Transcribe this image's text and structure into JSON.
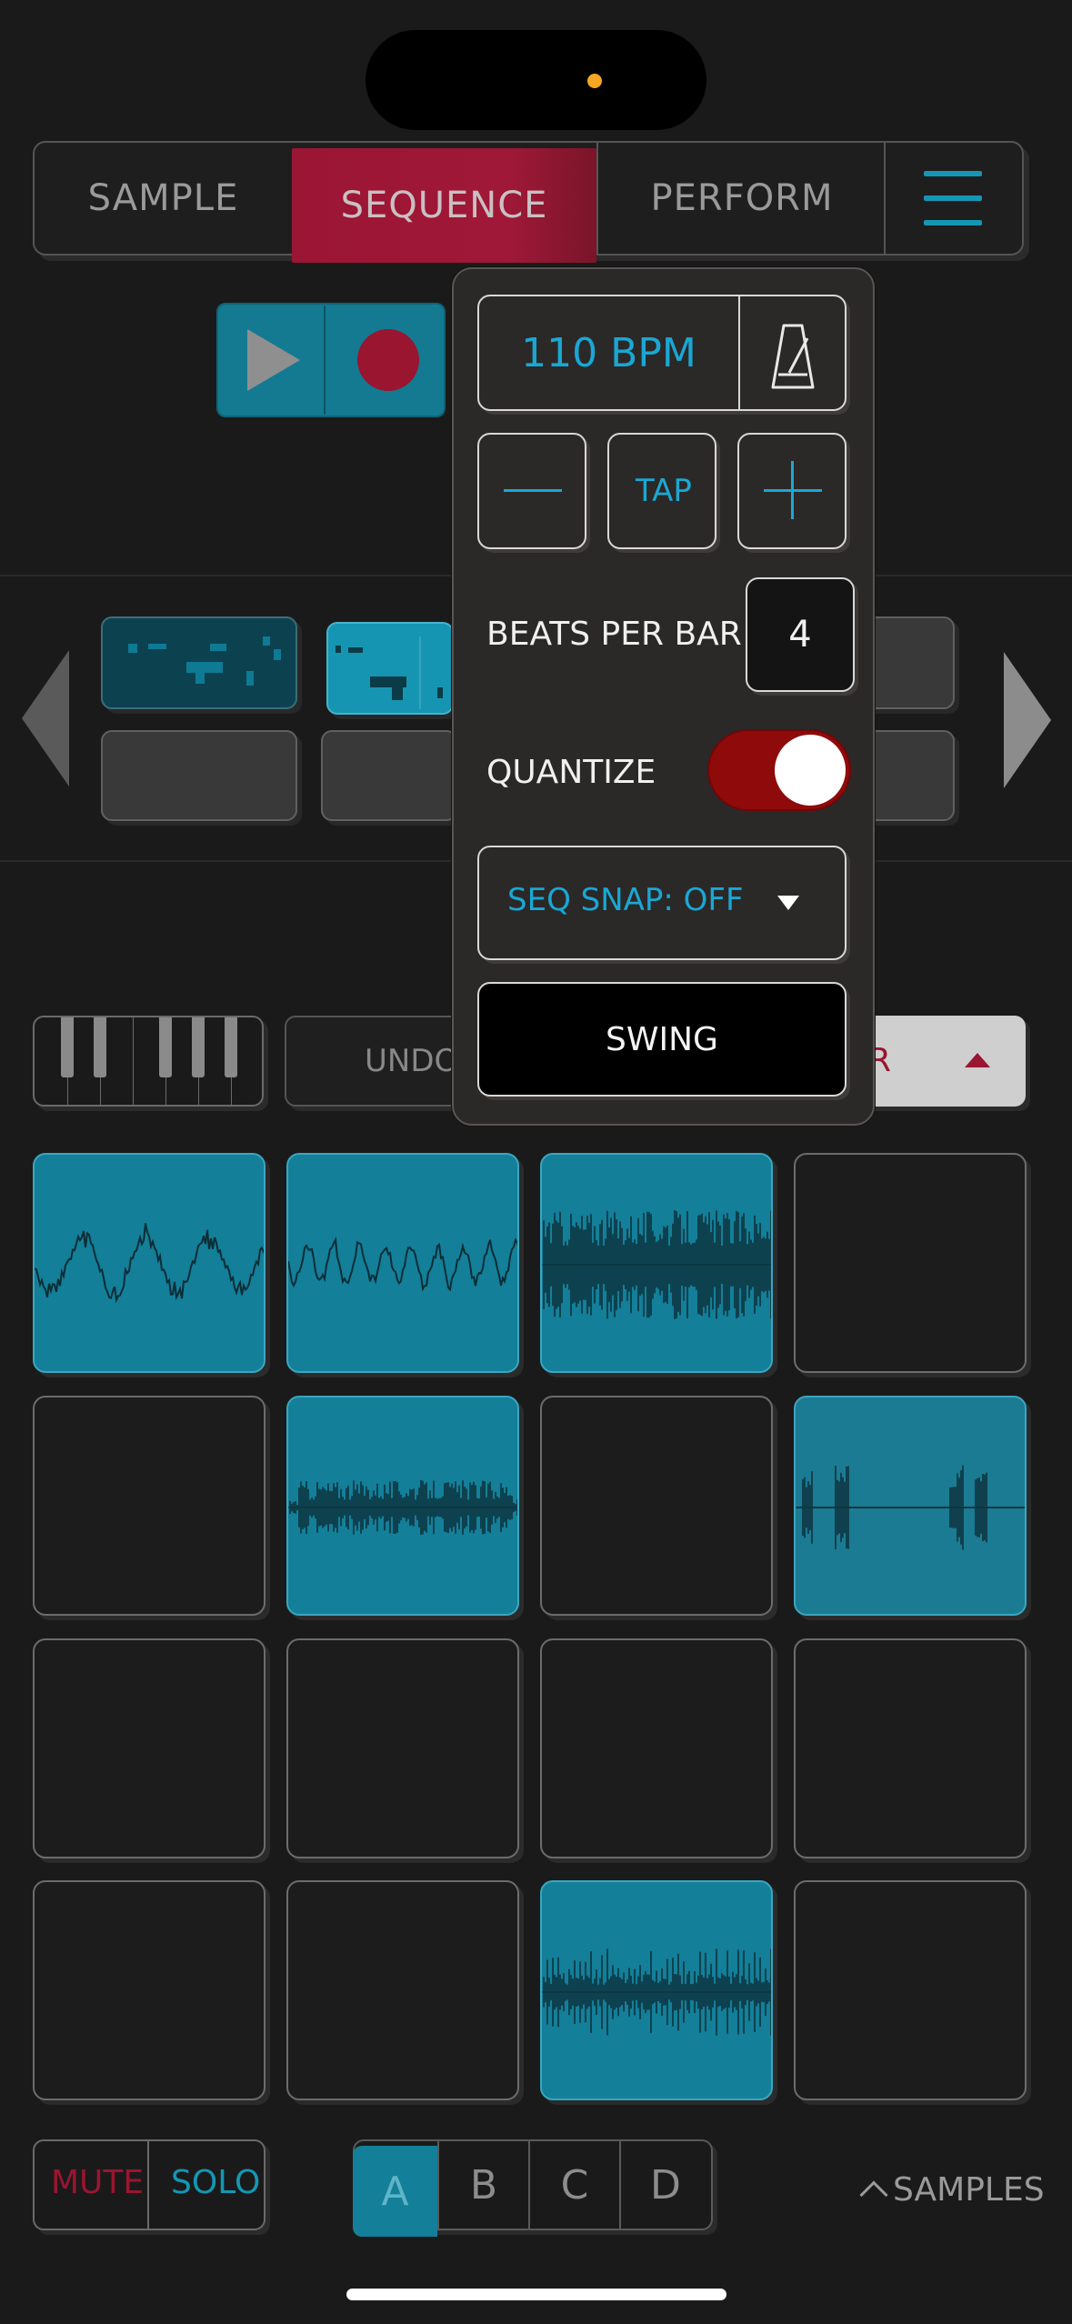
{
  "tabs": [
    {
      "label": "SAMPLE"
    },
    {
      "label": "SEQUENCE",
      "active": true
    },
    {
      "label": "PERFORM"
    }
  ],
  "icons": {
    "menu": "hamburger-menu-icon",
    "play": "play-icon",
    "record": "record-icon",
    "metronome": "metronome-icon",
    "minus": "minus-icon",
    "plus": "plus-icon",
    "dropdown": "caret-down-icon",
    "prev": "chevron-left-icon",
    "next": "chevron-right-icon",
    "keyboard": "piano-keyboard-icon"
  },
  "toolbar": {
    "undo_label": "UNDO",
    "partial_label": "R"
  },
  "tempo_popover": {
    "bpm_label": "110 BPM",
    "tap_label": "TAP",
    "beats_per_bar_label": "BEATS PER BAR",
    "beats_per_bar_value": "4",
    "quantize_label": "QUANTIZE",
    "quantize_on": true,
    "seq_snap_label": "SEQ SNAP: OFF",
    "swing_label": "SWING"
  },
  "pads": [
    {
      "loaded": true,
      "wave": "sine-low"
    },
    {
      "loaded": true,
      "wave": "sine-high"
    },
    {
      "loaded": true,
      "wave": "dense"
    },
    {
      "loaded": false
    },
    {
      "loaded": false
    },
    {
      "loaded": true,
      "wave": "burst"
    },
    {
      "loaded": false
    },
    {
      "loaded": true,
      "wave": "clicks"
    },
    {
      "loaded": false
    },
    {
      "loaded": false
    },
    {
      "loaded": false
    },
    {
      "loaded": false
    },
    {
      "loaded": false
    },
    {
      "loaded": false
    },
    {
      "loaded": true,
      "wave": "noise"
    },
    {
      "loaded": false
    }
  ],
  "bottom": {
    "mute_label": "MUTE",
    "solo_label": "SOLO",
    "banks": [
      "A",
      "B",
      "C",
      "D"
    ],
    "active_bank": "A",
    "samples_label": "SAMPLES"
  },
  "colors": {
    "accent_teal": "#1497b4",
    "accent_red": "#9a1530",
    "bpm_blue": "#1aa7d4",
    "toggle_red": "#8f0a0a"
  }
}
